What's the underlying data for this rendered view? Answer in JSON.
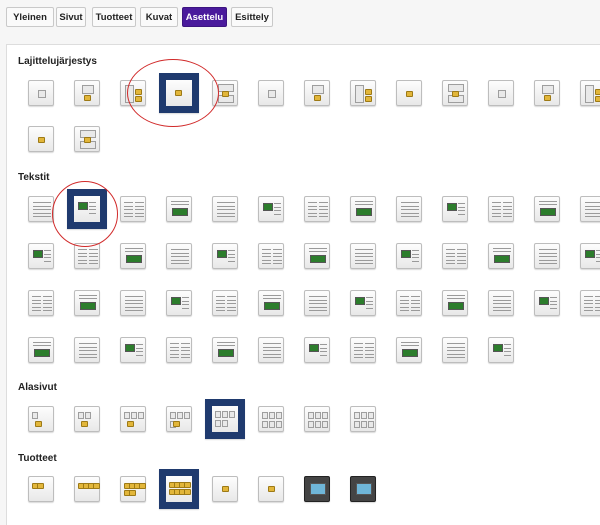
{
  "tabs": [
    {
      "label": "Yleinen",
      "active": false
    },
    {
      "label": "Sivut",
      "active": false
    },
    {
      "label": "Tuotteet",
      "active": false
    },
    {
      "label": "Kuvat",
      "active": false
    },
    {
      "label": "Asettelu",
      "active": true
    },
    {
      "label": "Esittely",
      "active": false
    }
  ],
  "sections": [
    {
      "title": "Lajittelujärjestys",
      "option_count": 15,
      "selected_index": 3
    },
    {
      "title": "Tekstit",
      "option_count": 50,
      "selected_index": 1
    },
    {
      "title": "Alasivut",
      "option_count": 8,
      "selected_index": 4
    },
    {
      "title": "Tuotteet",
      "option_count": 8,
      "selected_index": 3
    }
  ],
  "colors": {
    "active_tab": "#4a1a9c",
    "selection_border": "#1f3a6e",
    "annotation_circle": "#d12a2a"
  }
}
